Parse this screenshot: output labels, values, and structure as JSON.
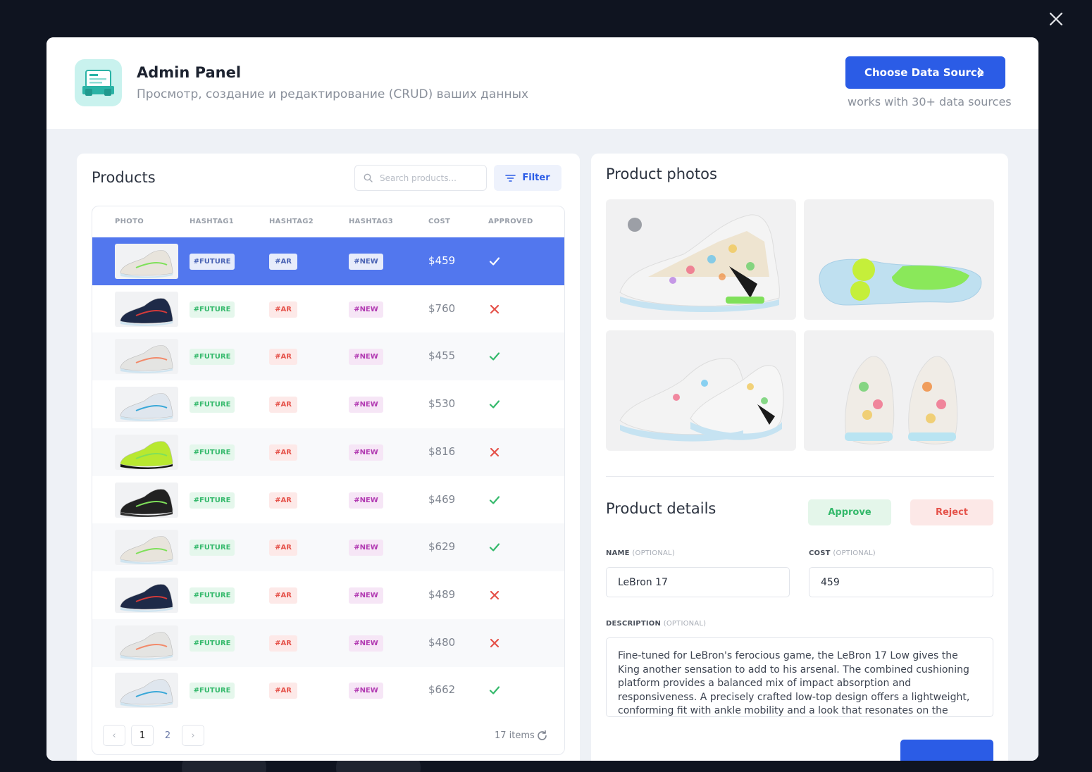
{
  "header": {
    "title": "Admin Panel",
    "subtitle": "Просмотр, создание и редактирование (CRUD) ваших данных",
    "cta_label": "Choose Data Source",
    "cta_note": "works with 30+ data sources"
  },
  "products": {
    "title": "Products",
    "search_placeholder": "Search products...",
    "filter_label": "Filter",
    "columns": [
      "PHOTO",
      "HASHTAG1",
      "HASHTAG2",
      "HASHTAG3",
      "COST",
      "APPROVED"
    ],
    "rows": [
      {
        "hashtag1": "#FUTURE",
        "hashtag2": "#AR",
        "hashtag3": "#NEW",
        "cost": "$459",
        "approved": true,
        "selected": true,
        "shoe": "lebron-white",
        "color": "#e8e4dc"
      },
      {
        "hashtag1": "#FUTURE",
        "hashtag2": "#AR",
        "hashtag3": "#NEW",
        "cost": "$760",
        "approved": false,
        "shoe": "navy-high",
        "color": "#1e2a48"
      },
      {
        "hashtag1": "#FUTURE",
        "hashtag2": "#AR",
        "hashtag3": "#NEW",
        "cost": "$455",
        "approved": true,
        "shoe": "white-runner",
        "color": "#e4e4e2"
      },
      {
        "hashtag1": "#FUTURE",
        "hashtag2": "#AR",
        "hashtag3": "#NEW",
        "cost": "$530",
        "approved": true,
        "shoe": "white-blue",
        "color": "#dfe6ee"
      },
      {
        "hashtag1": "#FUTURE",
        "hashtag2": "#AR",
        "hashtag3": "#NEW",
        "cost": "$816",
        "approved": false,
        "shoe": "volt-black",
        "color": "#b8e830"
      },
      {
        "hashtag1": "#FUTURE",
        "hashtag2": "#AR",
        "hashtag3": "#NEW",
        "cost": "$469",
        "approved": true,
        "shoe": "black-low",
        "color": "#222222"
      },
      {
        "hashtag1": "#FUTURE",
        "hashtag2": "#AR",
        "hashtag3": "#NEW",
        "cost": "$629",
        "approved": true,
        "shoe": "lebron-white",
        "color": "#e8e4dc"
      },
      {
        "hashtag1": "#FUTURE",
        "hashtag2": "#AR",
        "hashtag3": "#NEW",
        "cost": "$489",
        "approved": false,
        "shoe": "navy-high",
        "color": "#1e2a48"
      },
      {
        "hashtag1": "#FUTURE",
        "hashtag2": "#AR",
        "hashtag3": "#NEW",
        "cost": "$480",
        "approved": false,
        "shoe": "white-runner",
        "color": "#e4e4e2"
      },
      {
        "hashtag1": "#FUTURE",
        "hashtag2": "#AR",
        "hashtag3": "#NEW",
        "cost": "$662",
        "approved": true,
        "shoe": "white-blue",
        "color": "#dfe6ee"
      }
    ],
    "pages": [
      "1",
      "2"
    ],
    "prev_label": "‹",
    "next_label": "›",
    "items_count": "17 items"
  },
  "photos": {
    "title": "Product photos",
    "details_title": "Product details",
    "approve_label": "Approve",
    "reject_label": "Reject",
    "name_label": "NAME",
    "cost_label": "COST",
    "description_label": "DESCRIPTION",
    "optional": "(OPTIONAL)",
    "name_value": "LeBron 17",
    "cost_value": "459",
    "description_value": "Fine-tuned for LeBron's ferocious game, the LeBron 17 Low gives the King another sensation to add to his arsenal. The combined cushioning platform provides a balanced mix of impact absorption and responsiveness. A precisely crafted low-top design offers a lightweight, conforming fit with ankle mobility and a look that resonates on the street."
  },
  "colors": {
    "accent": "#2b5ce6",
    "selected_row": "#5277ee",
    "approve": "#34b96b",
    "reject": "#e5524a"
  }
}
